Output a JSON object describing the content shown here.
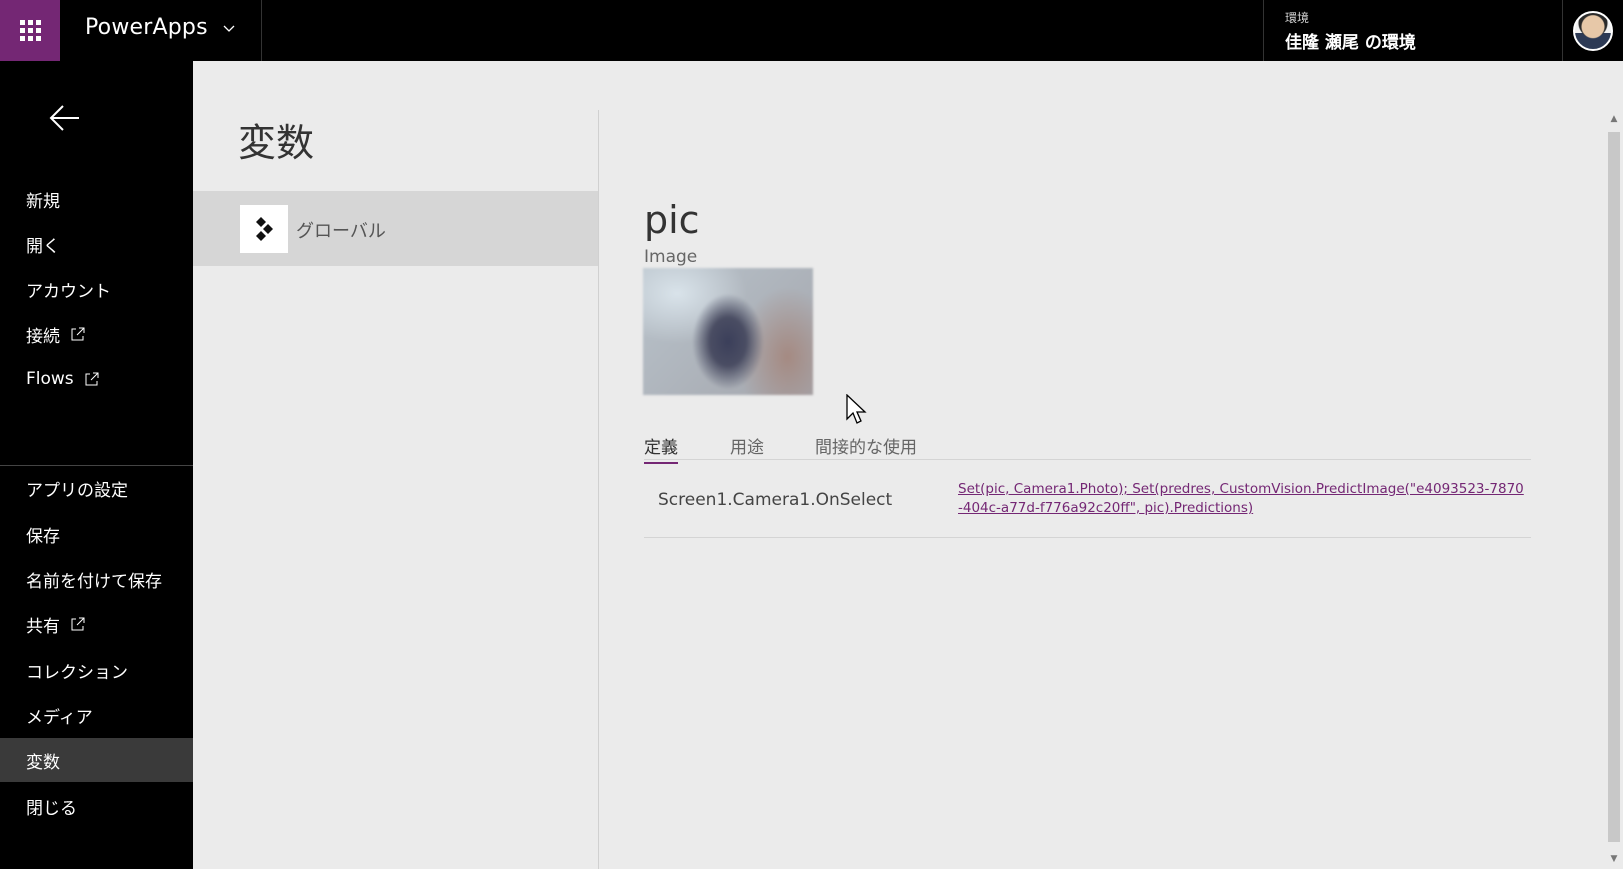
{
  "topbar": {
    "app_title": "PowerApps",
    "environment_label": "環境",
    "environment_name": "佳隆 瀬尾 の環境",
    "icons": [
      "waffle-icon",
      "chevron-down-icon",
      "avatar"
    ]
  },
  "leftnav": {
    "items": [
      {
        "label": "新規"
      },
      {
        "label": "開く"
      },
      {
        "label": "アカウント"
      },
      {
        "label": "接続",
        "external": true
      },
      {
        "label": "Flows",
        "external": true
      },
      {
        "label": "アプリの設定"
      },
      {
        "label": "保存"
      },
      {
        "label": "名前を付けて保存"
      },
      {
        "label": "共有",
        "external": true
      },
      {
        "label": "コレクション"
      },
      {
        "label": "メディア"
      },
      {
        "label": "変数",
        "active": true
      },
      {
        "label": "閉じる"
      }
    ]
  },
  "variables": {
    "title": "変数",
    "scope_label": "グローバル"
  },
  "detail": {
    "name": "pic",
    "type": "Image",
    "tabs": [
      {
        "label": "定義",
        "active": true
      },
      {
        "label": "用途"
      },
      {
        "label": "間接的な使用"
      }
    ],
    "rows": [
      {
        "location": "Screen1.Camera1.OnSelect",
        "formula": "Set(pic, Camera1.Photo); Set(predres, CustomVision.PredictImage(\"e4093523-7870-404c-a77d-f776a92c20ff\", pic).Predictions)"
      }
    ]
  },
  "colors": {
    "brand": "#742774",
    "topbar": "#000000",
    "nav_active": "#3a3a3a",
    "content_bg": "#ebebeb"
  }
}
